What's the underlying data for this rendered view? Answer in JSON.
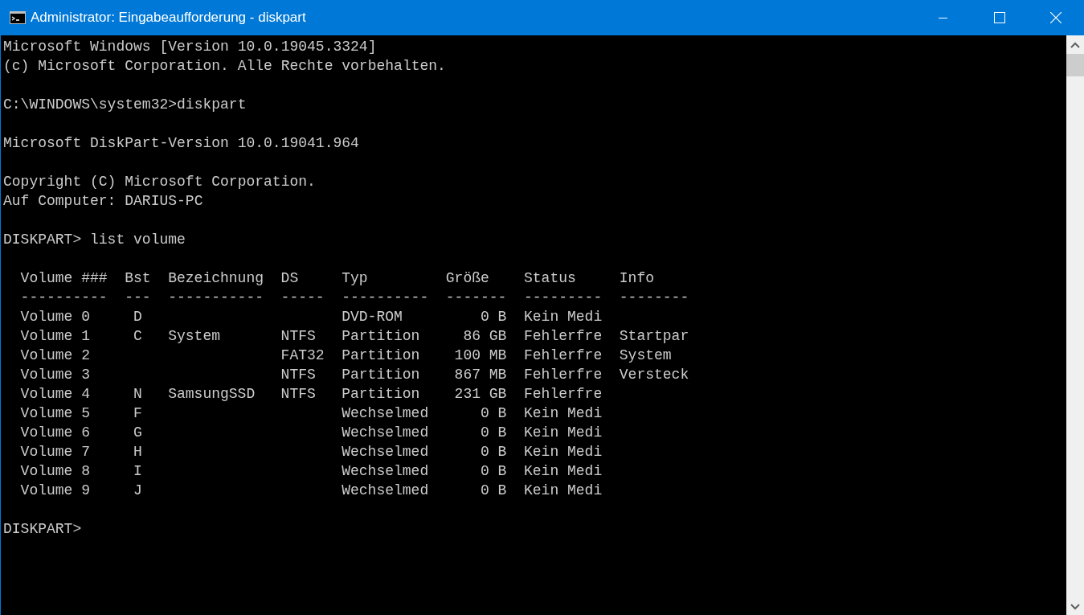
{
  "window": {
    "title": "Administrator: Eingabeaufforderung - diskpart"
  },
  "console": {
    "blocks": [
      [
        "Microsoft Windows [Version 10.0.19045.3324]",
        "(c) Microsoft Corporation. Alle Rechte vorbehalten."
      ],
      [
        "C:\\WINDOWS\\system32>diskpart"
      ],
      [
        "Microsoft DiskPart-Version 10.0.19041.964"
      ],
      [
        "Copyright (C) Microsoft Corporation.",
        "Auf Computer: DARIUS-PC"
      ],
      [
        "DISKPART> list volume"
      ]
    ],
    "table": {
      "columns": [
        {
          "label": "Volume ###",
          "rule": "----------"
        },
        {
          "label": "Bst",
          "rule": "---"
        },
        {
          "label": "Bezeichnung",
          "rule": "-----------"
        },
        {
          "label": "DS",
          "rule": "-----"
        },
        {
          "label": "Typ",
          "rule": "----------"
        },
        {
          "label": "Größe",
          "rule": "-------"
        },
        {
          "label": "Status",
          "rule": "---------"
        },
        {
          "label": "Info",
          "rule": "--------"
        }
      ],
      "rows": [
        [
          "Volume 0",
          "D",
          null,
          null,
          "DVD-ROM",
          "0 B",
          "Kein Medi",
          null
        ],
        [
          "Volume 1",
          "C",
          "System",
          "NTFS",
          "Partition",
          "86 GB",
          "Fehlerfre",
          "Startpar"
        ],
        [
          "Volume 2",
          null,
          null,
          "FAT32",
          "Partition",
          "100 MB",
          "Fehlerfre",
          "System"
        ],
        [
          "Volume 3",
          null,
          null,
          "NTFS",
          "Partition",
          "867 MB",
          "Fehlerfre",
          "Versteck"
        ],
        [
          "Volume 4",
          "N",
          "SamsungSSD",
          "NTFS",
          "Partition",
          "231 GB",
          "Fehlerfre",
          null
        ],
        [
          "Volume 5",
          "F",
          null,
          null,
          "Wechselmed",
          "0 B",
          "Kein Medi",
          null
        ],
        [
          "Volume 6",
          "G",
          null,
          null,
          "Wechselmed",
          "0 B",
          "Kein Medi",
          null
        ],
        [
          "Volume 7",
          "H",
          null,
          null,
          "Wechselmed",
          "0 B",
          "Kein Medi",
          null
        ],
        [
          "Volume 8",
          "I",
          null,
          null,
          "Wechselmed",
          "0 B",
          "Kein Medi",
          null
        ],
        [
          "Volume 9",
          "J",
          null,
          null,
          "Wechselmed",
          "0 B",
          "Kein Medi",
          null
        ]
      ]
    },
    "prompt": "DISKPART>"
  }
}
